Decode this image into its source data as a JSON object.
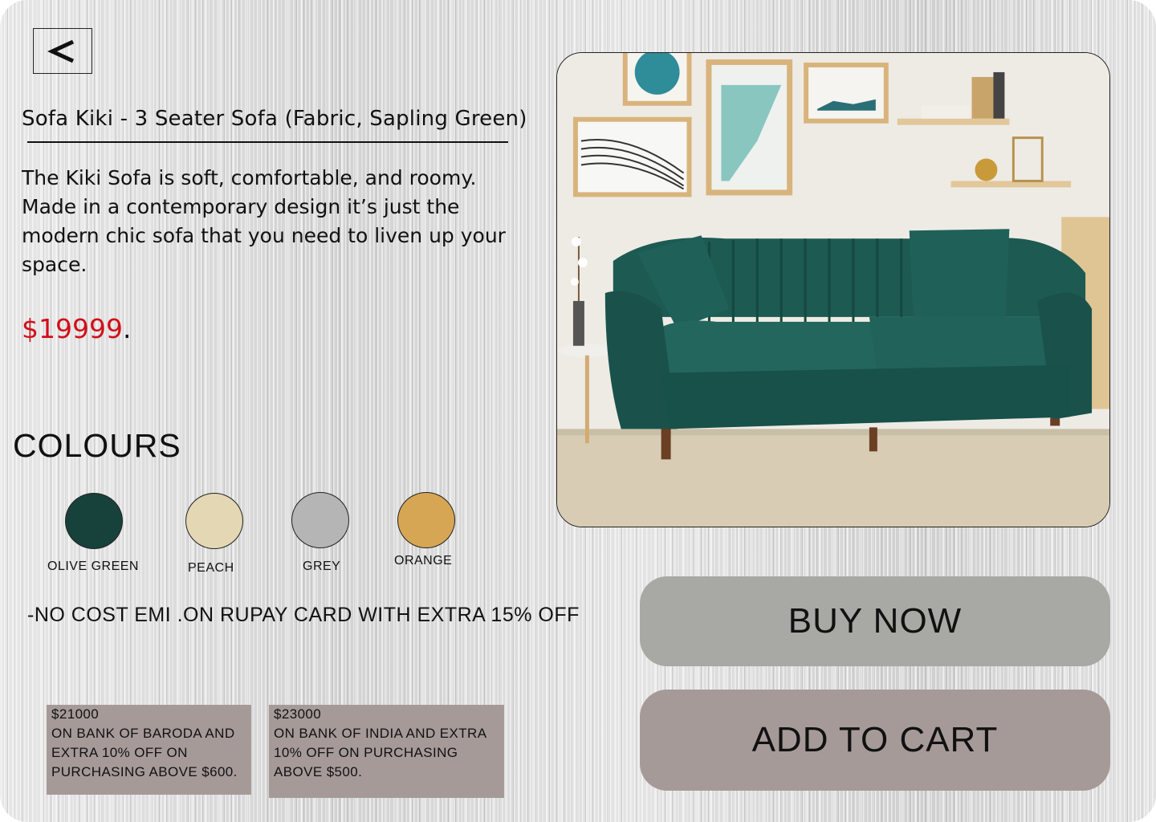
{
  "navigation": {
    "back_icon": "chevron-left-icon"
  },
  "product": {
    "title": "Sofa Kiki - 3 Seater Sofa (Fabric, Sapling Green)",
    "description": "The Kiki Sofa is soft, comfortable, and roomy. Made in a contemporary design it’s just the modern chic sofa that you need to liven up your space.",
    "price": "$19999",
    "price_suffix": ".",
    "price_color": "#d0101a"
  },
  "colours": {
    "heading": "COLOURS",
    "options": [
      {
        "label": "OLIVE GREEN",
        "color": "#17413b"
      },
      {
        "label": "PEACH",
        "color": "#e4d7b4"
      },
      {
        "label": "GREY",
        "color": "#b5b5b5"
      },
      {
        "label": "ORANGE",
        "color": "#d7a654"
      }
    ]
  },
  "emi_note": "-NO COST EMI .ON RUPAY CARD WITH EXTRA 15% OFF",
  "offers": [
    {
      "amount": "$21000",
      "lines": [
        "ON BANK OF BARODA AND",
        "EXTRA 10% OFF ON",
        "PURCHASING ABOVE $600."
      ]
    },
    {
      "amount": "$23000",
      "lines": [
        "ON BANK OF INDIA AND EXTRA",
        "10% OFF ON PURCHASING",
        "ABOVE $500."
      ]
    }
  ],
  "actions": {
    "buy_now": "BUY NOW",
    "add_to_cart": "ADD TO CART",
    "buy_color": "#a8a8a4",
    "cart_color": "#a69a99"
  }
}
